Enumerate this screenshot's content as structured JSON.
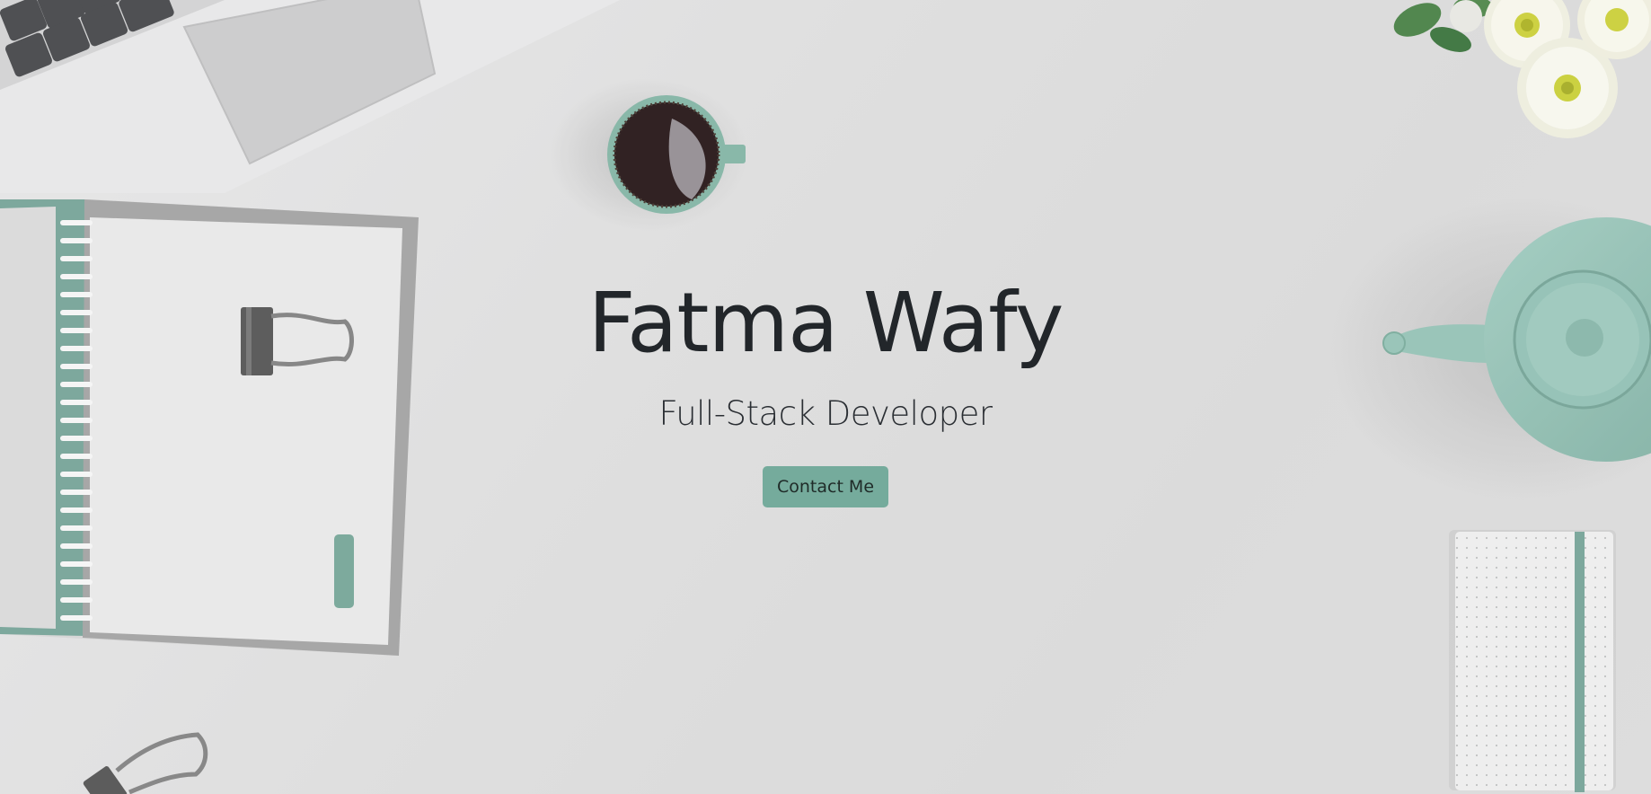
{
  "hero": {
    "name": "Fatma Wafy",
    "role": "Full-Stack Developer",
    "cta_label": "Contact Me"
  },
  "colors": {
    "accent": "#75ab9c",
    "text": "#22262a",
    "background": "#d9d9d9"
  },
  "background_objects": [
    "laptop-icon",
    "notebook-icon",
    "binder-clip-icon",
    "coffee-cup-icon",
    "teapot-icon",
    "daisy-flowers-icon",
    "dotted-notebook-icon"
  ]
}
